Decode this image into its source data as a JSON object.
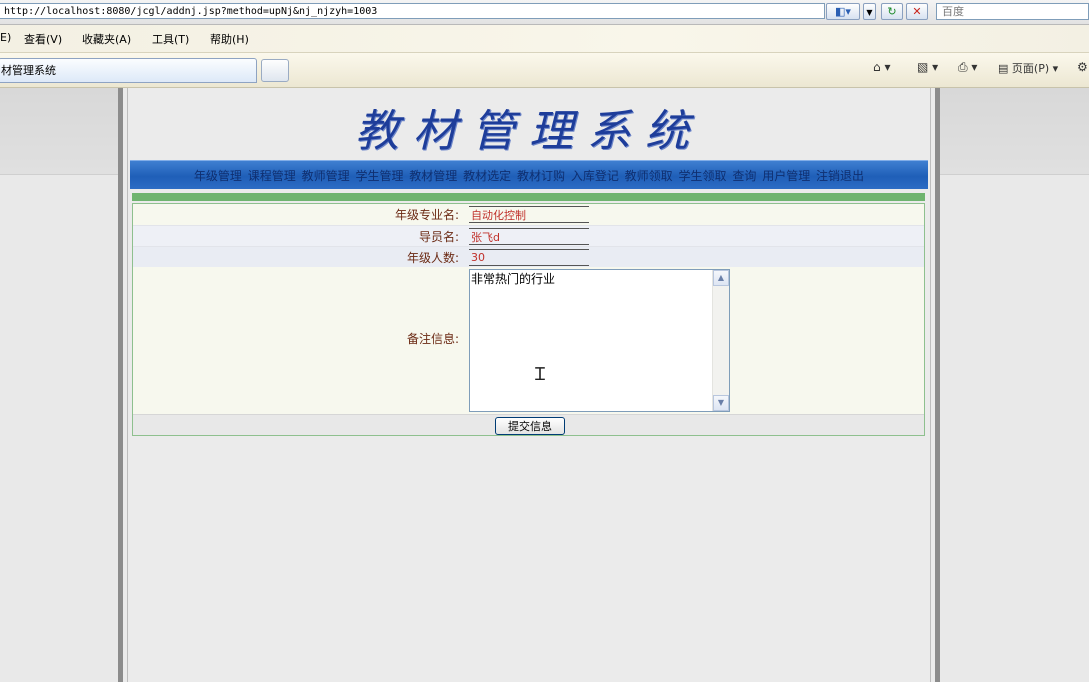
{
  "browser": {
    "url": "http://localhost:8080/jcgl/addnj.jsp?method=upNj&nj_njzyh=1003",
    "search_placeholder": "百度",
    "menu": [
      "E)",
      "查看(V)",
      "收藏夹(A)",
      "工具(T)",
      "帮助(H)"
    ],
    "tab_title": "材管理系统",
    "tools": {
      "page": "页面(P)"
    },
    "icons": [
      "compat-view-icon",
      "refresh-icon",
      "stop-icon",
      "home-icon",
      "feed-icon",
      "print-icon",
      "page-icon",
      "settings-icon"
    ]
  },
  "page": {
    "title": "教材管理系统",
    "nav": [
      "年级管理",
      "课程管理",
      "教师管理",
      "学生管理",
      "教材管理",
      "教材选定",
      "教材订购",
      "入库登记",
      "教师领取",
      "学生领取",
      "查询",
      "用户管理",
      "注销退出"
    ],
    "form": {
      "major_label": "年级专业名:",
      "major_value": "自动化控制",
      "advisor_label": "导员名:",
      "advisor_value": "张飞d",
      "count_label": "年级人数:",
      "count_value": "30",
      "remark_label": "备注信息:",
      "remark_value": "非常热门的行业",
      "submit_label": "提交信息"
    }
  },
  "colors": {
    "title": "#1e3d9a",
    "nav_bar": "#1f5fb8",
    "label": "#6b2a14",
    "field_text": "#c0302a",
    "green_bar": "#6fb46f"
  }
}
